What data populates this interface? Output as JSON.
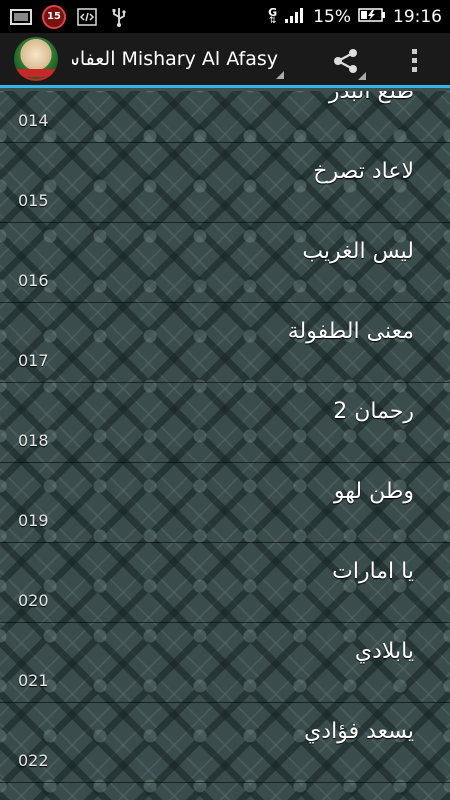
{
  "status_bar": {
    "icons": [
      "image-icon",
      "calendar-badge-icon",
      "code-icon",
      "usb-icon"
    ],
    "badge_count": "15",
    "network": "G",
    "battery_percent": "15%",
    "time": "19:16"
  },
  "action_bar": {
    "title": "Mishary Al Afasy العفاسي",
    "share_icon": "share-icon",
    "overflow_icon": "overflow-menu-icon"
  },
  "list": {
    "items": [
      {
        "title": "طلع البدر",
        "number": "014"
      },
      {
        "title": "لاعاد تصرخ",
        "number": "015"
      },
      {
        "title": "ليس الغريب",
        "number": "016"
      },
      {
        "title": "معنى الطفولة",
        "number": "017"
      },
      {
        "title": "رحمان 2",
        "number": "018"
      },
      {
        "title": "وطن لهو",
        "number": "019"
      },
      {
        "title": "يا امارات",
        "number": "020"
      },
      {
        "title": "يابلادي",
        "number": "021"
      },
      {
        "title": "يسعد فؤادي",
        "number": "022"
      }
    ]
  }
}
